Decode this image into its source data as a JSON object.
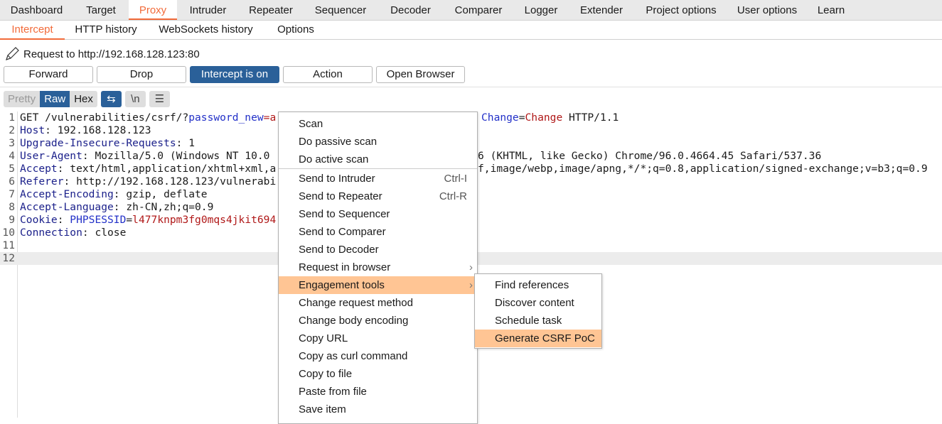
{
  "main_tabs": [
    "Dashboard",
    "Target",
    "Proxy",
    "Intruder",
    "Repeater",
    "Sequencer",
    "Decoder",
    "Comparer",
    "Logger",
    "Extender",
    "Project options",
    "User options",
    "Learn"
  ],
  "sub_tabs": [
    "Intercept",
    "HTTP history",
    "WebSockets history",
    "Options"
  ],
  "request_label": "Request to http://192.168.128.123:80",
  "buttons": {
    "forward": "Forward",
    "drop": "Drop",
    "intercept": "Intercept is on",
    "action": "Action",
    "open_browser": "Open Browser"
  },
  "view": {
    "pretty": "Pretty",
    "raw": "Raw",
    "hex": "Hex",
    "newline": "\\n",
    "wrap_icon": "wrap-icon",
    "menu_icon": "menu-icon"
  },
  "lines": [
    {
      "n": "1",
      "a": "GET /vulnerabilities/csrf/?",
      "b": "password_new",
      "c": "=a",
      "r1": "Change",
      "r2": "=",
      "r3": "Change",
      "r4": " HTTP/1.1"
    },
    {
      "n": "2",
      "k": "Host",
      "t": ": 192.168.128.123"
    },
    {
      "n": "3",
      "k": "Upgrade-Insecure-Requests",
      "t": ": 1"
    },
    {
      "n": "4",
      "k": "User-Agent",
      "t": ": Mozilla/5.0 (Windows NT 10.0",
      "r": "6 (KHTML, like Gecko) Chrome/96.0.4664.45 Safari/537.36"
    },
    {
      "n": "5",
      "k": "Accept",
      "t": ": text/html,application/xhtml+xml,a",
      "r": "f,image/webp,image/apng,*/*;q=0.8,application/signed-exchange;v=b3;q=0.9"
    },
    {
      "n": "6",
      "k": "Referer",
      "t": ": http://192.168.128.123/vulnerabi"
    },
    {
      "n": "7",
      "k": "Accept-Encoding",
      "t": ": gzip, deflate"
    },
    {
      "n": "8",
      "k": "Accept-Language",
      "t": ": zh-CN,zh;q=0.9"
    },
    {
      "n": "9",
      "k": "Cookie",
      "t": ": ",
      "p": "PHPSESSID",
      "e": "=",
      "v": "l477knpm3fg0mqs4jkit694"
    },
    {
      "n": "10",
      "k": "Connection",
      "t": ": close"
    },
    {
      "n": "11"
    },
    {
      "n": "12"
    }
  ],
  "context_menu": [
    {
      "label": "Scan"
    },
    {
      "label": "Do passive scan"
    },
    {
      "label": "Do active scan"
    },
    {
      "label": "Send to Intruder",
      "shortcut": "Ctrl-I"
    },
    {
      "label": "Send to Repeater",
      "shortcut": "Ctrl-R"
    },
    {
      "label": "Send to Sequencer"
    },
    {
      "label": "Send to Comparer"
    },
    {
      "label": "Send to Decoder"
    },
    {
      "label": "Request in browser"
    },
    {
      "label": "Engagement tools"
    },
    {
      "label": "Change request method"
    },
    {
      "label": "Change body encoding"
    },
    {
      "label": "Copy URL"
    },
    {
      "label": "Copy as curl command"
    },
    {
      "label": "Copy to file"
    },
    {
      "label": "Paste from file"
    },
    {
      "label": "Save item"
    }
  ],
  "submenu": [
    "Find references",
    "Discover content",
    "Schedule task",
    "Generate CSRF PoC"
  ]
}
